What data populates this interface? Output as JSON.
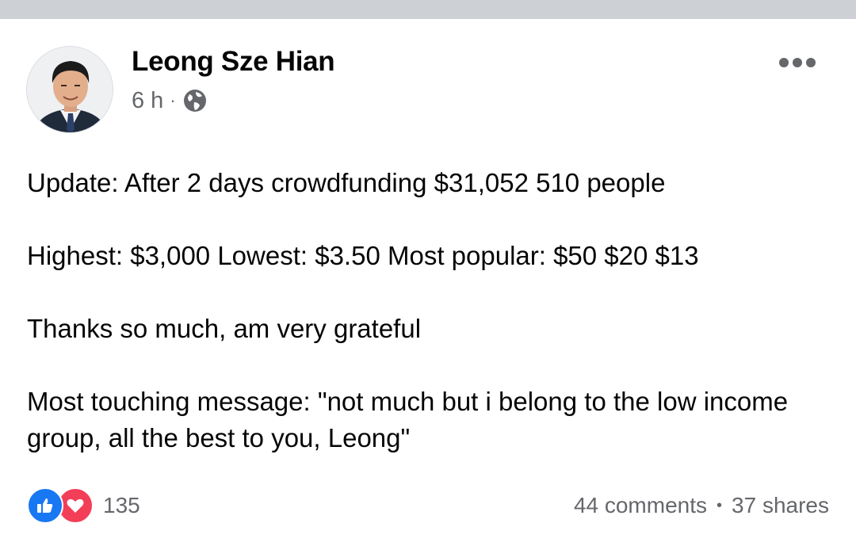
{
  "post": {
    "author": "Leong Sze Hian",
    "time": "6 h",
    "meta_separator": "·",
    "audience_icon": "globe-icon",
    "more_icon": "more-dots-icon",
    "paragraphs": [
      "Update: After 2 days crowdfunding $31,052 510 people",
      "Highest: $3,000 Lowest: $3.50 Most popular: $50 $20 $13",
      "Thanks so much, am very grateful",
      "Most touching message: \"not much but i belong to the low income group, all the best to you, Leong\""
    ]
  },
  "footer": {
    "reaction_icons": [
      "like-icon",
      "love-icon"
    ],
    "reaction_count": "135",
    "comments": "44 comments",
    "separator": "•",
    "shares": "37 shares"
  },
  "colors": {
    "like": "#1877f2",
    "love": "#f33e58",
    "secondary_text": "#65676b",
    "primary_text": "#050505",
    "top_strip": "#cdd0d4"
  }
}
